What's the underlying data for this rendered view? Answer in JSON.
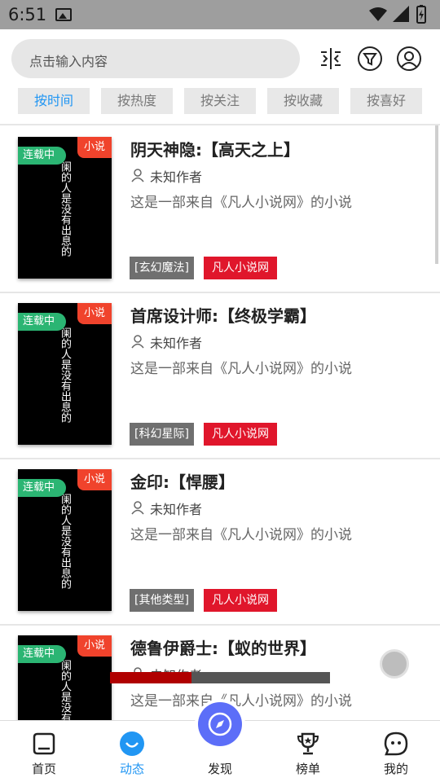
{
  "status_bar": {
    "time": "6:51"
  },
  "search": {
    "placeholder": "点击输入内容"
  },
  "header_icons": [
    "compare-icon",
    "filter-icon",
    "user-icon"
  ],
  "filters": [
    {
      "label": "按时间",
      "active": true
    },
    {
      "label": "按热度",
      "active": false
    },
    {
      "label": "按关注",
      "active": false
    },
    {
      "label": "按收藏",
      "active": false
    },
    {
      "label": "按喜好",
      "active": false
    }
  ],
  "books": [
    {
      "serial_badge": "连载中",
      "type_badge": "小说",
      "cover_text": "阑的人是没有出息的",
      "title": "阴天神隐:【高天之上】",
      "author": "未知作者",
      "desc": "这是一部来自《凡人小说网》的小说",
      "category": "[玄幻魔法]",
      "source": "凡人小说网"
    },
    {
      "serial_badge": "连载中",
      "type_badge": "小说",
      "cover_text": "阑的人是没有出息的",
      "title": "首席设计师:【终极学霸】",
      "author": "未知作者",
      "desc": "这是一部来自《凡人小说网》的小说",
      "category": "[科幻星际]",
      "source": "凡人小说网"
    },
    {
      "serial_badge": "连载中",
      "type_badge": "小说",
      "cover_text": "阑的人是没有出息的",
      "title": "金印:【悍腰】",
      "author": "未知作者",
      "desc": "这是一部来自《凡人小说网》的小说",
      "category": "[其他类型]",
      "source": "凡人小说网"
    },
    {
      "serial_badge": "连载中",
      "type_badge": "小说",
      "cover_text": "阑的人是没有出息的",
      "title": "德鲁伊爵士:【蚁的世界】",
      "author": "未知作者",
      "desc": "这是一部来自《凡人小说网》的小说",
      "category": "",
      "source": ""
    }
  ],
  "overlay_progress": {
    "fraction": 0.37,
    "fill_color": "#b00000",
    "track_color": "#555555"
  },
  "bottom_nav": [
    {
      "label": "首页",
      "icon": "home-icon",
      "active": false
    },
    {
      "label": "动态",
      "icon": "smile-icon",
      "active": true
    },
    {
      "label": "发现",
      "icon": "compass-icon",
      "active": false
    },
    {
      "label": "榜单",
      "icon": "trophy-icon",
      "active": false
    },
    {
      "label": "我的",
      "icon": "face-icon",
      "active": false
    }
  ],
  "colors": {
    "accent": "#2196f3",
    "serial_green": "#2bb573",
    "type_red": "#f0432c",
    "source_red": "#e0162b",
    "category_gray": "#6f6f6f",
    "discover_blue": "#5c6ef8"
  }
}
